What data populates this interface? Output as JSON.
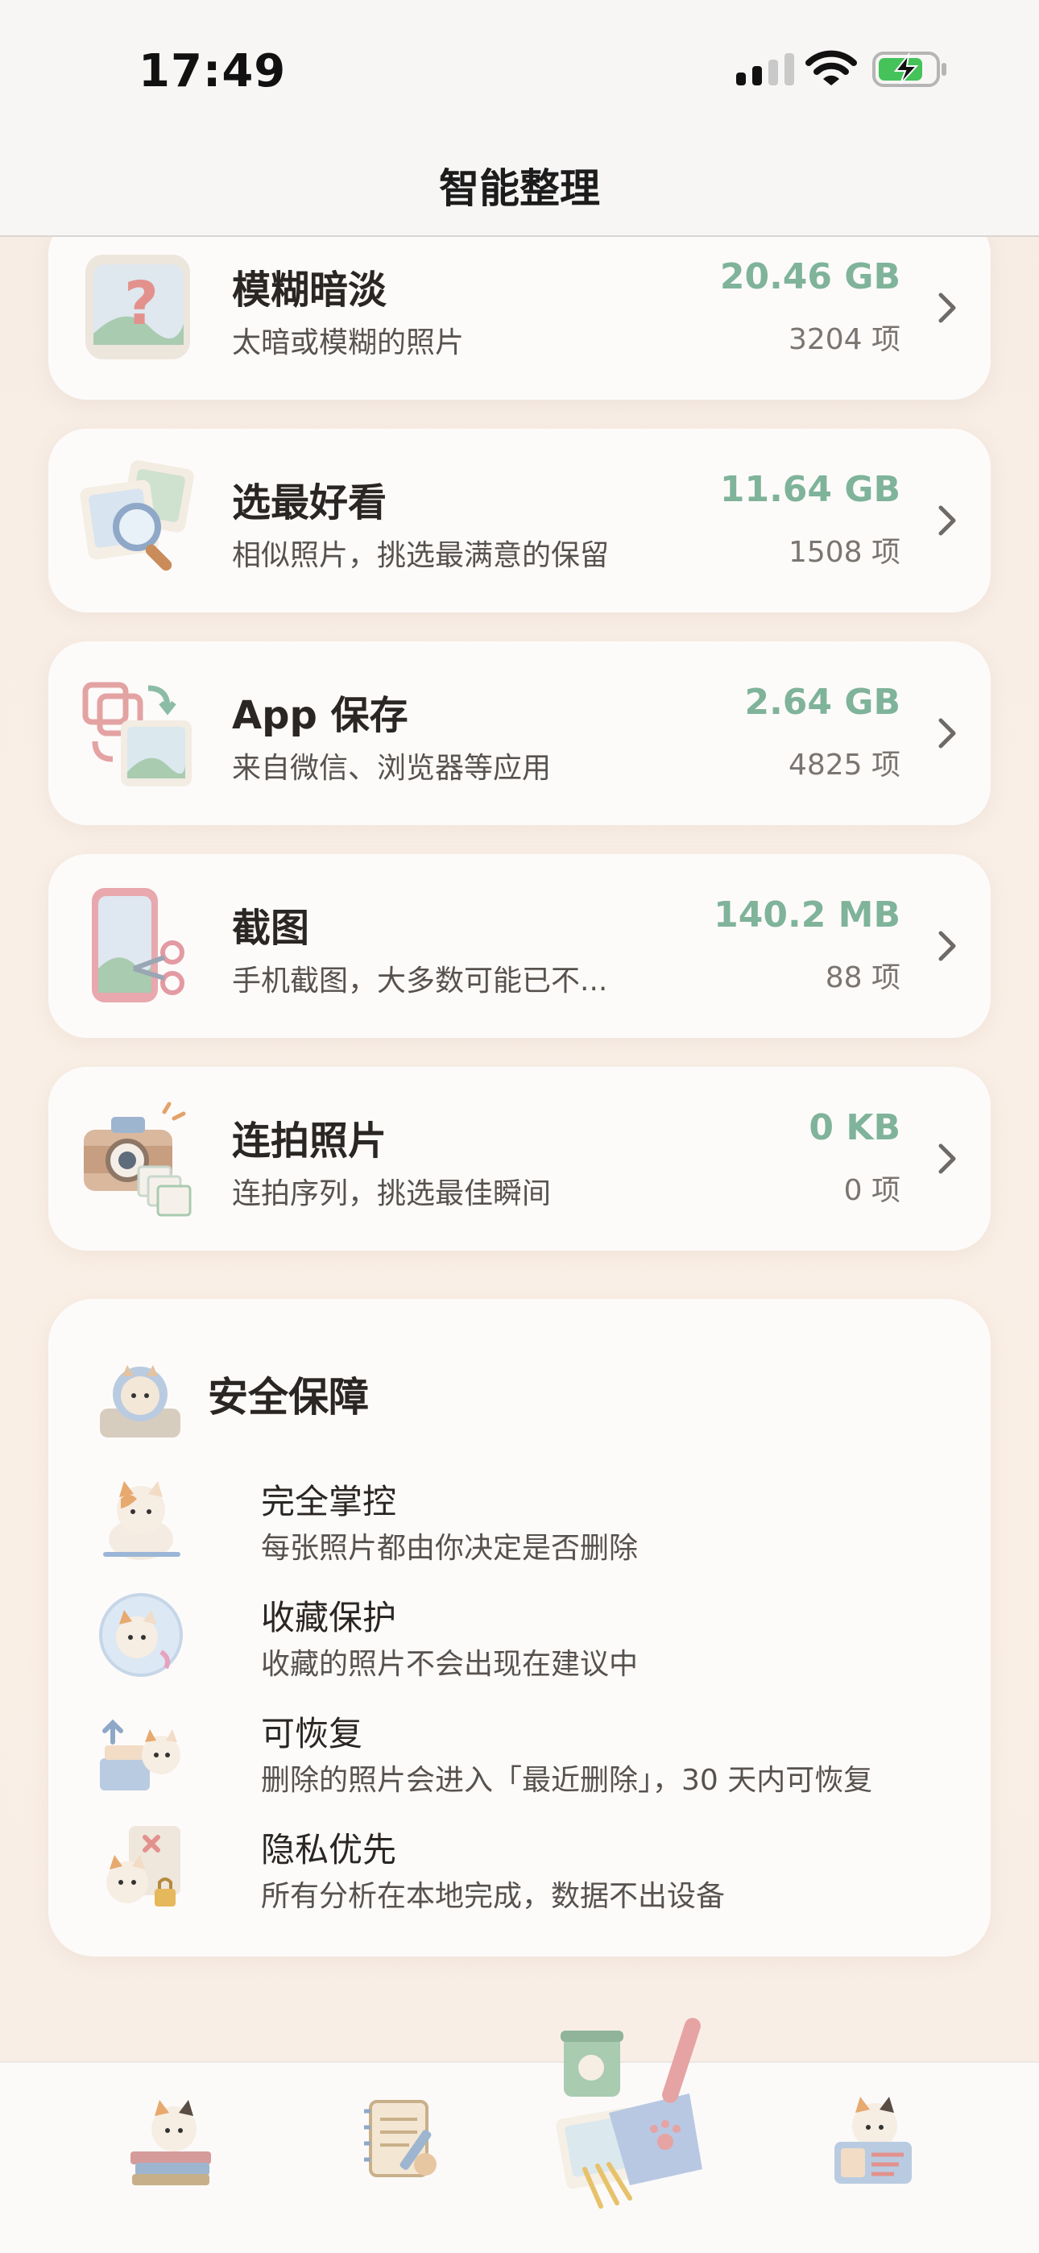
{
  "status_bar": {
    "time": "17:49"
  },
  "nav": {
    "title": "智能整理"
  },
  "categories": [
    {
      "title": "模糊暗淡",
      "subtitle": "太暗或模糊的照片",
      "size": "20.46 GB",
      "count": "3204 项",
      "icon": "question-photo-icon"
    },
    {
      "title": "选最好看",
      "subtitle": "相似照片，挑选最满意的保留",
      "size": "11.64 GB",
      "count": "1508 项",
      "icon": "magnifier-photos-icon"
    },
    {
      "title": "App 保存",
      "subtitle": "来自微信、浏览器等应用",
      "size": "2.64 GB",
      "count": "4825 项",
      "icon": "app-transfer-icon"
    },
    {
      "title": "截图",
      "subtitle": "手机截图，大多数可能已不...",
      "size": "140.2 MB",
      "count": "88 项",
      "icon": "phone-scissors-icon"
    },
    {
      "title": "连拍照片",
      "subtitle": "连拍序列，挑选最佳瞬间",
      "size": "0 KB",
      "count": "0 项",
      "icon": "camera-burst-icon"
    }
  ],
  "safety": {
    "title": "安全保障",
    "items": [
      {
        "title": "完全掌控",
        "subtitle": "每张照片都由你决定是否删除",
        "icon": "cat-control-icon"
      },
      {
        "title": "收藏保护",
        "subtitle": "收藏的照片不会出现在建议中",
        "icon": "cat-bubble-icon"
      },
      {
        "title": "可恢复",
        "subtitle": "删除的照片会进入「最近删除」，30 天内可恢复",
        "icon": "cat-recover-icon"
      },
      {
        "title": "隐私优先",
        "subtitle": "所有分析在本地完成，数据不出设备",
        "icon": "cat-privacy-icon"
      }
    ]
  },
  "tabbar": {
    "tabs": [
      {
        "icon": "cat-books-icon"
      },
      {
        "icon": "notebook-pen-icon"
      },
      {
        "icon": "dustpan-cleanup-icon"
      },
      {
        "icon": "cat-id-card-icon"
      }
    ]
  },
  "colors": {
    "accent_green": "#7fb39a",
    "card_bg": "#fdfbfa",
    "background": "#f8eee5"
  }
}
